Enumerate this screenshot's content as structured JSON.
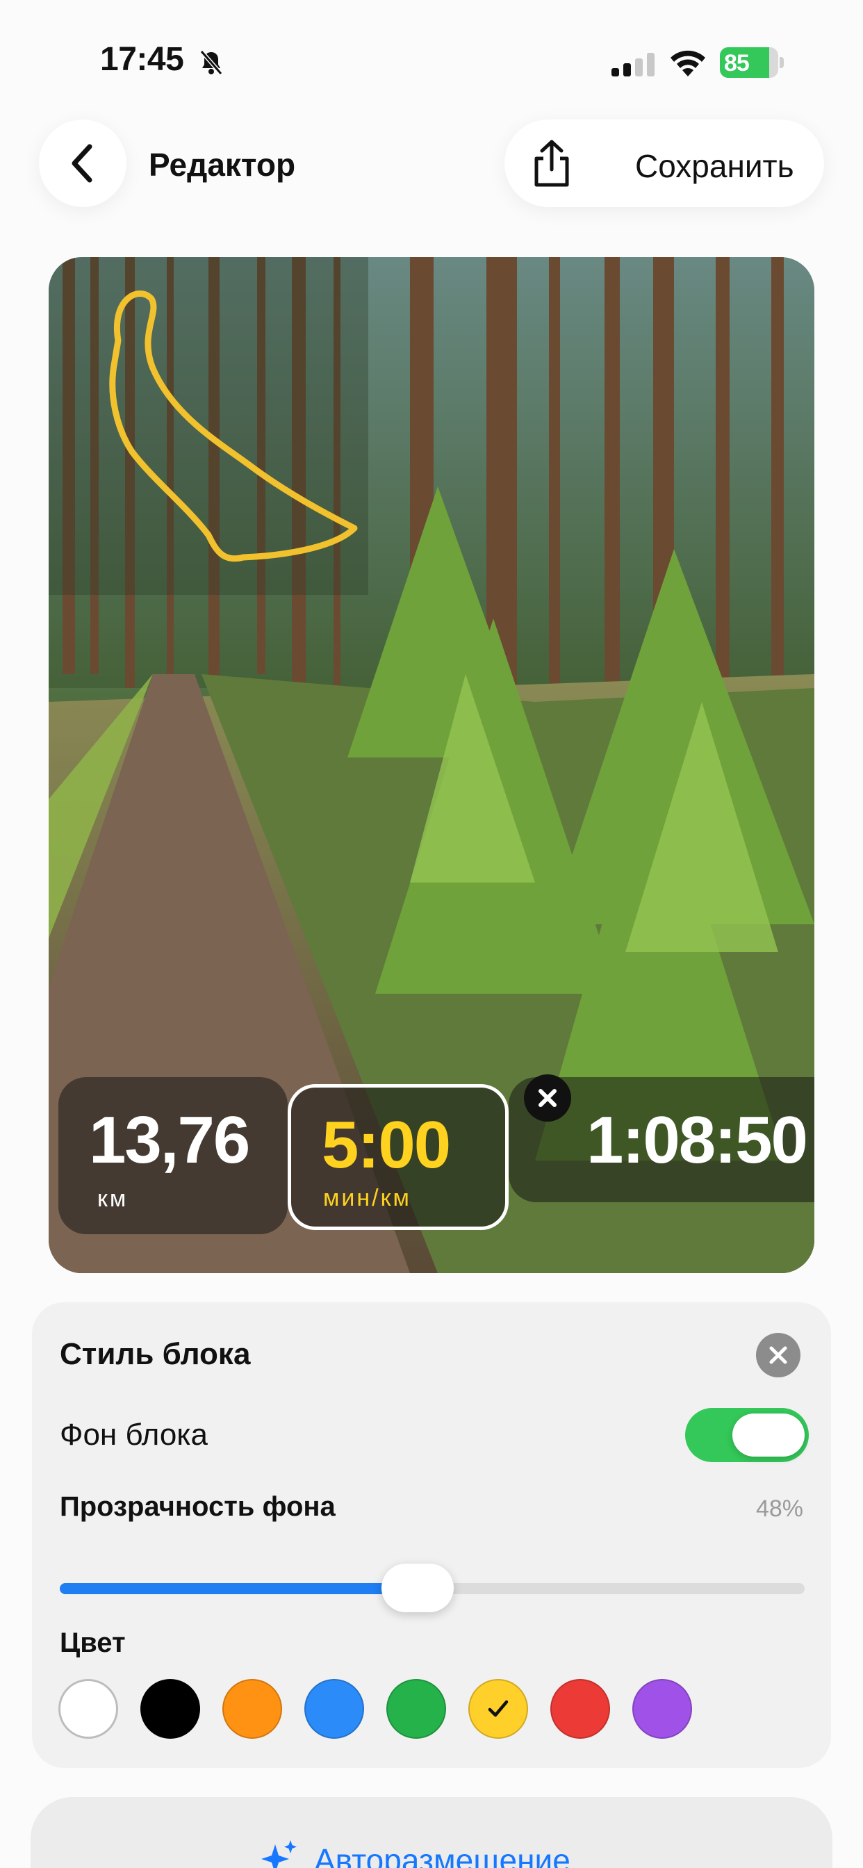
{
  "status_bar": {
    "time": "17:45",
    "battery": "85",
    "battery_level": 0.85,
    "icons": [
      "bell-slash-icon",
      "cellular-signal-icon",
      "wifi-icon",
      "battery-icon"
    ]
  },
  "header": {
    "title": "Редактор",
    "save_label": "Сохранить",
    "icons": [
      "chevron-left-icon",
      "share-icon"
    ]
  },
  "stats": [
    {
      "value": "13,76",
      "unit": "км",
      "selected": false
    },
    {
      "value": "5:00",
      "unit": "мин/км",
      "selected": true
    },
    {
      "value": "1:08:50",
      "unit": "",
      "selected": false
    }
  ],
  "route_color": "#f2c12e",
  "style_panel": {
    "title": "Стиль блока",
    "background_label": "Фон блока",
    "background_enabled": true,
    "opacity_label": "Прозрачность фона",
    "opacity_value": "48%",
    "opacity_level": 0.48,
    "color_label": "Цвет",
    "colors": [
      {
        "name": "white",
        "hex": "#ffffff",
        "selected": false
      },
      {
        "name": "black",
        "hex": "#000000",
        "selected": false
      },
      {
        "name": "orange",
        "hex": "#ff9212",
        "selected": false
      },
      {
        "name": "blue",
        "hex": "#2b8bf8",
        "selected": false
      },
      {
        "name": "green",
        "hex": "#25b24a",
        "selected": false
      },
      {
        "name": "yellow",
        "hex": "#ffcf2a",
        "selected": true
      },
      {
        "name": "red",
        "hex": "#ec3b36",
        "selected": false
      },
      {
        "name": "purple",
        "hex": "#a052e8",
        "selected": false
      }
    ]
  },
  "auto_button": {
    "label": "Авторазмещение",
    "icon": "sparkles-icon"
  },
  "colors": {
    "accent_blue": "#1e7ef2",
    "toggle_green": "#34c759",
    "selected_text": "#ffd21f"
  }
}
